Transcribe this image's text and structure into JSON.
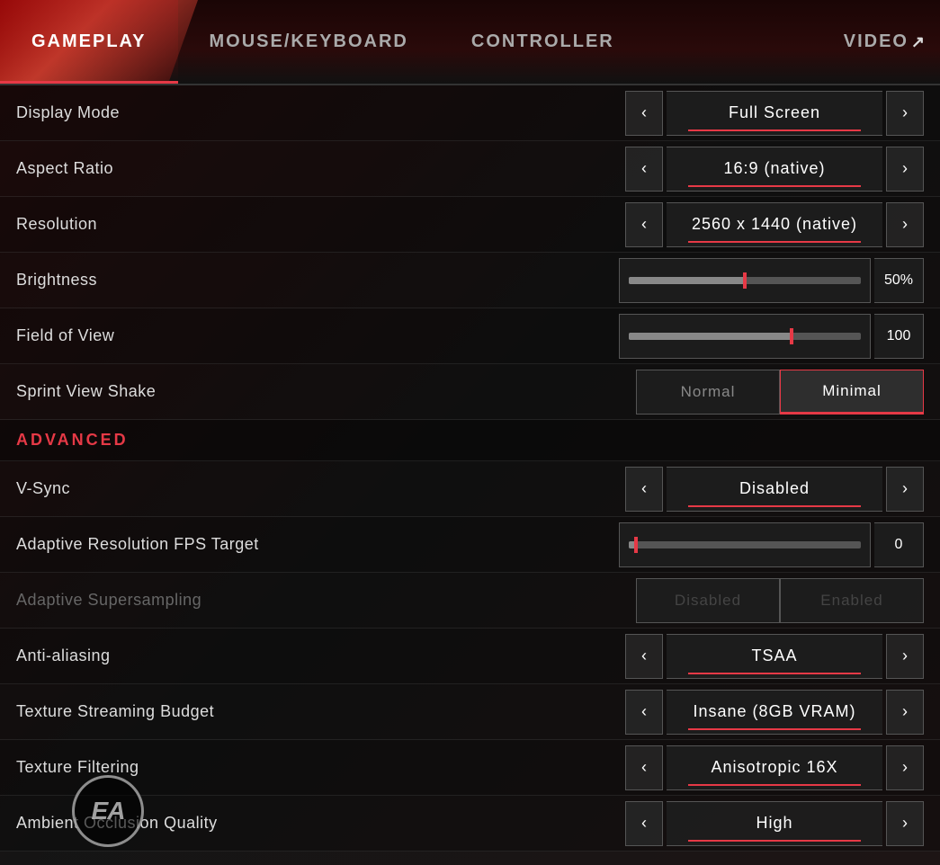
{
  "header": {
    "tabs": [
      {
        "id": "gameplay",
        "label": "GAMEPLAY",
        "active": true
      },
      {
        "id": "mouse_keyboard",
        "label": "MOUSE/KEYBOARD",
        "active": false
      },
      {
        "id": "controller",
        "label": "CONTROLLER",
        "active": false
      },
      {
        "id": "video",
        "label": "VIDEO",
        "active": false
      }
    ]
  },
  "settings": {
    "display_mode": {
      "label": "Display Mode",
      "value": "Full Screen"
    },
    "aspect_ratio": {
      "label": "Aspect Ratio",
      "value": "16:9 (native)"
    },
    "resolution": {
      "label": "Resolution",
      "value": "2560 x 1440 (native)"
    },
    "brightness": {
      "label": "Brightness",
      "value": "50%",
      "fill_pct": 50
    },
    "field_of_view": {
      "label": "Field of View",
      "value": "100",
      "fill_pct": 70
    },
    "sprint_view_shake": {
      "label": "Sprint View Shake",
      "options": [
        "Normal",
        "Minimal"
      ],
      "selected": "Minimal"
    }
  },
  "advanced_label": "ADVANCED",
  "advanced": {
    "vsync": {
      "label": "V-Sync",
      "value": "Disabled"
    },
    "adaptive_res": {
      "label": "Adaptive Resolution FPS Target",
      "value": "0",
      "fill_pct": 3
    },
    "adaptive_supersampling": {
      "label": "Adaptive Supersampling",
      "options": [
        "Disabled",
        "Enabled"
      ],
      "selected": "Disabled",
      "disabled": true
    },
    "anti_aliasing": {
      "label": "Anti-aliasing",
      "value": "TSAA"
    },
    "texture_streaming": {
      "label": "Texture Streaming Budget",
      "value": "Insane (8GB VRAM)"
    },
    "texture_filtering": {
      "label": "Texture Filtering",
      "value": "Anisotropic 16X"
    },
    "ambient_occlusion": {
      "label": "Ambient Occlusion Quality",
      "value": "High"
    }
  },
  "ea_logo_text": "EA",
  "arrow_left": "‹",
  "arrow_right": "›"
}
